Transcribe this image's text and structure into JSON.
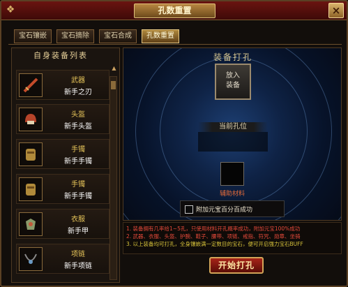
{
  "window": {
    "title": "孔数重置",
    "close_glyph": "×"
  },
  "tabs": [
    {
      "label": "宝石镶嵌",
      "active": false
    },
    {
      "label": "宝石摘除",
      "active": false
    },
    {
      "label": "宝石合成",
      "active": false
    },
    {
      "label": "孔数重置",
      "active": true
    }
  ],
  "left_panel": {
    "title": "自身装备列表",
    "items": [
      {
        "type": "武器",
        "name": "新手之刃",
        "icon": "sword-icon"
      },
      {
        "type": "头盔",
        "name": "新手头盔",
        "icon": "helmet-icon"
      },
      {
        "type": "手镯",
        "name": "新手手镯",
        "icon": "bracelet-icon"
      },
      {
        "type": "手镯",
        "name": "新手手镯",
        "icon": "bracelet-icon"
      },
      {
        "type": "衣服",
        "name": "新手甲",
        "icon": "armor-icon"
      },
      {
        "type": "项链",
        "name": "新手项链",
        "icon": "necklace-icon"
      }
    ]
  },
  "right_panel": {
    "title": "装备打孔",
    "put_label_line1": "放入",
    "put_label_line2": "装备",
    "current_holes_label": "当前孔位",
    "material_label": "辅助材料",
    "checkbox_label": "附加元宝百分百成功"
  },
  "notes": [
    "1. 装备拥有几率给1~5孔，只使用材料开孔概率成功，附加元宝100%成功",
    "2. 武器、衣服、头盔、护腕、鞋子、腰带、项链、戒指、符咒、勋章、坐骑",
    "3. 以上装备均可打孔，全身镶嵌满一定数目的宝石，便可开启强力宝石BUFF"
  ],
  "start_button": "开始打孔",
  "colors": {
    "note1": "#e64a3a",
    "note2": "#e64a3a",
    "note3": "#d6c13a",
    "item_type": "#e8c65a"
  }
}
